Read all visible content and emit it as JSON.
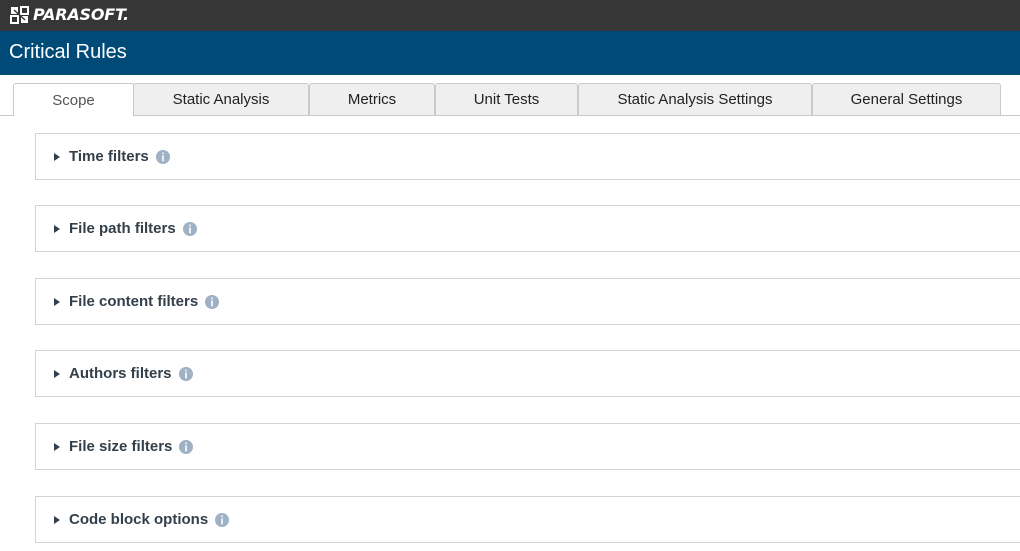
{
  "brand": {
    "name": "PARASOFT."
  },
  "header": {
    "title": "Critical Rules"
  },
  "tabs": [
    {
      "label": "Scope",
      "active": true
    },
    {
      "label": "Static Analysis",
      "active": false
    },
    {
      "label": "Metrics",
      "active": false
    },
    {
      "label": "Unit Tests",
      "active": false
    },
    {
      "label": "Static Analysis Settings",
      "active": false
    },
    {
      "label": "General Settings",
      "active": false
    }
  ],
  "panels": [
    {
      "label": "Time filters",
      "icon": "info-icon"
    },
    {
      "label": "File path filters",
      "icon": "info-icon"
    },
    {
      "label": "File content filters",
      "icon": "info-icon"
    },
    {
      "label": "Authors filters",
      "icon": "info-icon"
    },
    {
      "label": "File size filters",
      "icon": "info-icon"
    },
    {
      "label": "Code block options",
      "icon": "info-icon"
    }
  ],
  "colors": {
    "topbar": "#363636",
    "titlebar": "#004a78",
    "panel_text": "#333f4a",
    "info_icon": "#9fb1c4"
  }
}
